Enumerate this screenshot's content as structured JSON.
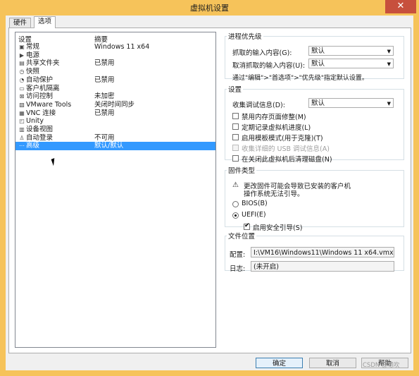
{
  "window": {
    "title": "虚拟机设置",
    "close_glyph": "✕"
  },
  "tabs": [
    {
      "label": "硬件"
    },
    {
      "label": "选项"
    }
  ],
  "list": {
    "col_setting": "设置",
    "col_summary": "摘要",
    "items": [
      {
        "icon": "▣",
        "name": "常规",
        "summary": "Windows 11 x64"
      },
      {
        "icon": "▶",
        "name": "电源",
        "summary": ""
      },
      {
        "icon": "▤",
        "name": "共享文件夹",
        "summary": "已禁用"
      },
      {
        "icon": "◷",
        "name": "快照",
        "summary": ""
      },
      {
        "icon": "◔",
        "name": "自动保护",
        "summary": "已禁用"
      },
      {
        "icon": "▭",
        "name": "客户机隔离",
        "summary": ""
      },
      {
        "icon": "⊠",
        "name": "访问控制",
        "summary": "未加密"
      },
      {
        "icon": "▧",
        "name": "VMware Tools",
        "summary": "关闭时间同步"
      },
      {
        "icon": "▦",
        "name": "VNC 连接",
        "summary": "已禁用"
      },
      {
        "icon": "◰",
        "name": "Unity",
        "summary": ""
      },
      {
        "icon": "▥",
        "name": "设备视图",
        "summary": ""
      },
      {
        "icon": "♙",
        "name": "自动登录",
        "summary": "不可用"
      },
      {
        "icon": "⋯",
        "name": "高级",
        "summary": "默认/默认"
      }
    ]
  },
  "priority": {
    "legend": "进程优先级",
    "grabbed_label": "抓取的输入内容(G):",
    "grabbed_value": "默认",
    "ungrabbed_label": "取消抓取的输入内容(U):",
    "ungrabbed_value": "默认",
    "hint": "通过\"编辑\">\"首选项\">\"优先级\"指定默认设置。"
  },
  "settings": {
    "legend": "设置",
    "debug_label": "收集调试信息(D):",
    "debug_value": "默认",
    "opt1": "禁用内存页面修整(M)",
    "opt2": "定期记录虚拟机进度(L)",
    "opt3": "启用模板模式(用于克隆)(T)",
    "opt4": "收集详细的 USB 调试信息(A)",
    "opt5": "在关闭此虚拟机后清理磁盘(N)"
  },
  "firmware": {
    "legend": "固件类型",
    "warning_line1": "更改固件可能会导致已安装的客户机",
    "warning_line2": "操作系统无法引导。",
    "bios": "BIOS(B)",
    "uefi": "UEFI(E)",
    "secure_boot": "启用安全引导(S)"
  },
  "files": {
    "legend": "文件位置",
    "config_label": "配置:",
    "config_value": "I:\\VM16\\Windows11\\Windows 11 x64.vmx",
    "log_label": "日志:",
    "log_value": "(未开启)"
  },
  "buttons": {
    "ok": "确定",
    "cancel": "取消",
    "help": "帮助"
  },
  "watermark": "CSDN @嗯吹"
}
